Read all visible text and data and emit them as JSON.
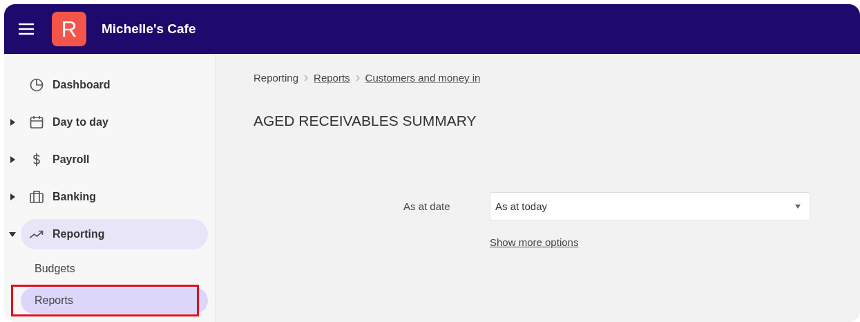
{
  "header": {
    "logo_letter": "R",
    "business_name": "Michelle's Cafe"
  },
  "sidebar": {
    "items": [
      {
        "label": "Dashboard",
        "selected": false
      },
      {
        "label": "Day to day",
        "expanded": false,
        "selected": false
      },
      {
        "label": "Payroll",
        "expanded": false,
        "selected": false
      },
      {
        "label": "Banking",
        "expanded": false,
        "selected": false
      },
      {
        "label": "Reporting",
        "expanded": true,
        "selected": true,
        "children": [
          {
            "label": "Budgets",
            "selected": false,
            "highlighted": false
          },
          {
            "label": "Reports",
            "selected": true,
            "highlighted": true
          }
        ]
      }
    ]
  },
  "breadcrumbs": [
    {
      "label": "Reporting",
      "link": false
    },
    {
      "label": "Reports",
      "link": true
    },
    {
      "label": "Customers and money in",
      "link": true
    }
  ],
  "page_title": "AGED RECEIVABLES SUMMARY",
  "form": {
    "label": "As at date",
    "value": "As at today",
    "link": "Show more options"
  }
}
